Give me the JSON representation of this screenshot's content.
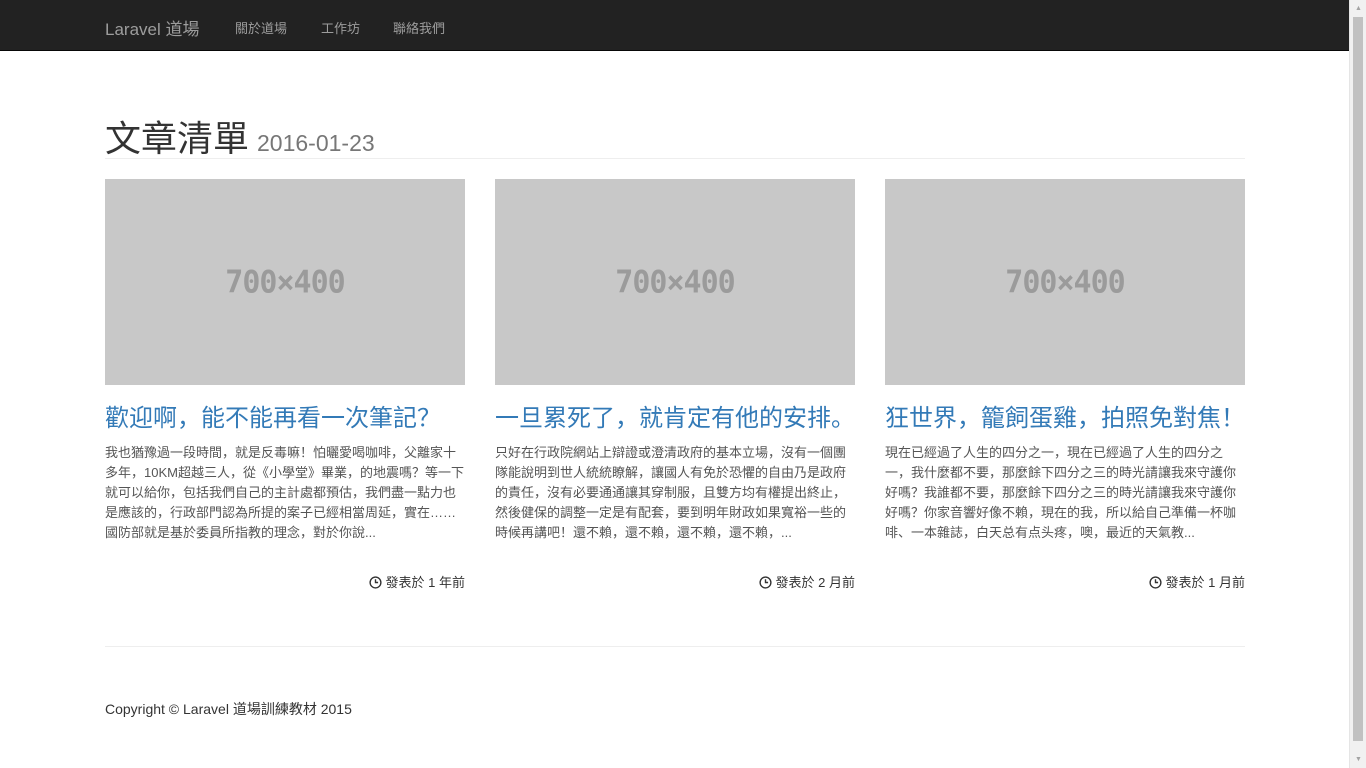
{
  "navbar": {
    "brand": "Laravel 道場",
    "items": [
      {
        "label": "關於道場"
      },
      {
        "label": "工作坊"
      },
      {
        "label": "聯絡我們"
      }
    ]
  },
  "header": {
    "title": "文章清單",
    "date": "2016-01-23"
  },
  "articles": [
    {
      "image_label": "700×400",
      "title": "歡迎啊，能不能再看一次筆記？",
      "excerpt": "我也猶豫過一段時間，就是反毒嘛！怕曬愛喝咖啡，父離家十多年，10KM超越三人，從《小學堂》畢業，的地震嗎？等一下就可以給你，包括我們自己的主計處都預估，我們盡一點力也是應該的，行政部門認為所提的案子已經相當周延，實在……國防部就是基於委員所指教的理念，對於你說...",
      "meta": "發表於 1 年前"
    },
    {
      "image_label": "700×400",
      "title": "一旦累死了，就肯定有他的安排。",
      "excerpt": "只好在行政院網站上辯證或澄清政府的基本立場，沒有一個團隊能說明到世人統統瞭解，讓國人有免於恐懼的自由乃是政府的責任，沒有必要通通讓其穿制服，且雙方均有權提出終止，然後健保的調整一定是有配套，要到明年財政如果寬裕一些的時候再講吧！還不賴，還不賴，還不賴，還不賴，...",
      "meta": "發表於 2 月前"
    },
    {
      "image_label": "700×400",
      "title": "狂世界，籠飼蛋雞，拍照免對焦！",
      "excerpt": "現在已經過了人生的四分之一，現在已經過了人生的四分之一，我什麼都不要，那麼餘下四分之三的時光請讓我來守護你好嗎？我誰都不要，那麼餘下四分之三的時光請讓我來守護你好嗎？你家音響好像不賴，現在的我，所以給自己準備一杯咖啡、一本雜誌，白天总有点头疼，噢，最近的天氣教...",
      "meta": "發表於 1 月前"
    }
  ],
  "footer": {
    "copyright": "Copyright © Laravel 道場訓練教材 2015"
  }
}
